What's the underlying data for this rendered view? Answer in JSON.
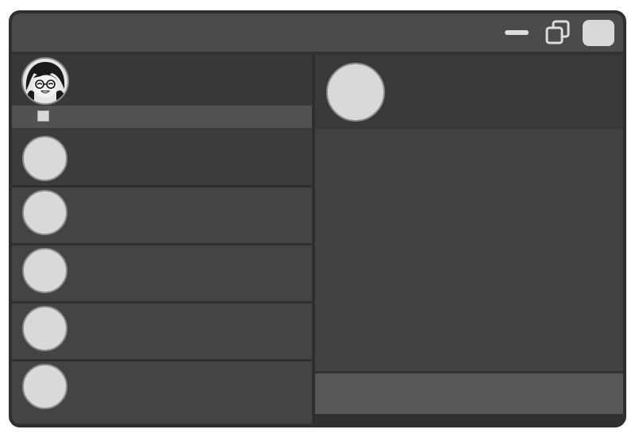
{
  "window": {
    "controls": {
      "minimize_icon": "minimize-icon",
      "maximize_icon": "restore-window-icon",
      "close_icon": "close-icon"
    }
  },
  "sidebar": {
    "profile": {
      "avatar_icon": "user-avatar-icon"
    },
    "search": {
      "icon": "search-checkbox-icon"
    },
    "contacts": [
      {
        "avatar_icon": "contact-avatar-icon"
      },
      {
        "avatar_icon": "contact-avatar-icon"
      },
      {
        "avatar_icon": "contact-avatar-icon"
      },
      {
        "avatar_icon": "contact-avatar-icon"
      },
      {
        "avatar_icon": "contact-avatar-icon"
      }
    ]
  },
  "chat": {
    "header": {
      "avatar_icon": "chat-avatar-icon"
    },
    "composer": {
      "placeholder": ""
    }
  },
  "colors": {
    "frame": "#2f2f2f",
    "titlebar": "#4b4b4b",
    "panel": "#3d3d3d",
    "avatar_fill": "#d9d9d9"
  }
}
